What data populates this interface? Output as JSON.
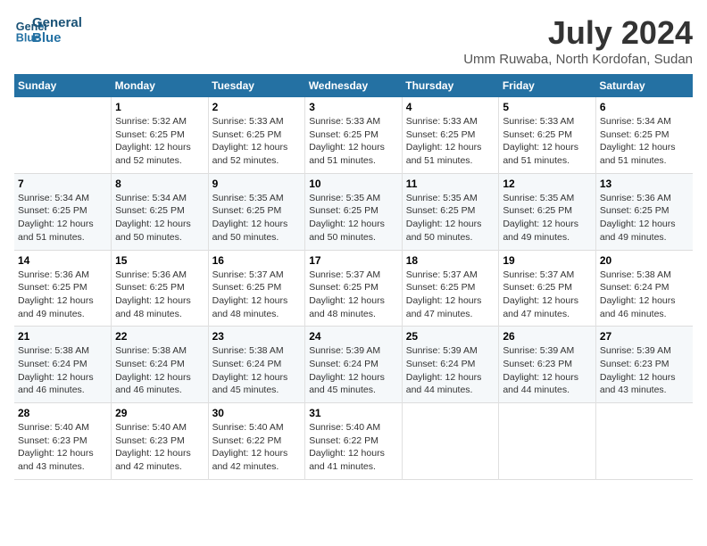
{
  "logo": {
    "line1": "General",
    "line2": "Blue"
  },
  "title": "July 2024",
  "subtitle": "Umm Ruwaba, North Kordofan, Sudan",
  "days_of_week": [
    "Sunday",
    "Monday",
    "Tuesday",
    "Wednesday",
    "Thursday",
    "Friday",
    "Saturday"
  ],
  "weeks": [
    [
      {
        "day": "",
        "info": ""
      },
      {
        "day": "1",
        "info": "Sunrise: 5:32 AM\nSunset: 6:25 PM\nDaylight: 12 hours\nand 52 minutes."
      },
      {
        "day": "2",
        "info": "Sunrise: 5:33 AM\nSunset: 6:25 PM\nDaylight: 12 hours\nand 52 minutes."
      },
      {
        "day": "3",
        "info": "Sunrise: 5:33 AM\nSunset: 6:25 PM\nDaylight: 12 hours\nand 51 minutes."
      },
      {
        "day": "4",
        "info": "Sunrise: 5:33 AM\nSunset: 6:25 PM\nDaylight: 12 hours\nand 51 minutes."
      },
      {
        "day": "5",
        "info": "Sunrise: 5:33 AM\nSunset: 6:25 PM\nDaylight: 12 hours\nand 51 minutes."
      },
      {
        "day": "6",
        "info": "Sunrise: 5:34 AM\nSunset: 6:25 PM\nDaylight: 12 hours\nand 51 minutes."
      }
    ],
    [
      {
        "day": "7",
        "info": "Sunrise: 5:34 AM\nSunset: 6:25 PM\nDaylight: 12 hours\nand 51 minutes."
      },
      {
        "day": "8",
        "info": "Sunrise: 5:34 AM\nSunset: 6:25 PM\nDaylight: 12 hours\nand 50 minutes."
      },
      {
        "day": "9",
        "info": "Sunrise: 5:35 AM\nSunset: 6:25 PM\nDaylight: 12 hours\nand 50 minutes."
      },
      {
        "day": "10",
        "info": "Sunrise: 5:35 AM\nSunset: 6:25 PM\nDaylight: 12 hours\nand 50 minutes."
      },
      {
        "day": "11",
        "info": "Sunrise: 5:35 AM\nSunset: 6:25 PM\nDaylight: 12 hours\nand 50 minutes."
      },
      {
        "day": "12",
        "info": "Sunrise: 5:35 AM\nSunset: 6:25 PM\nDaylight: 12 hours\nand 49 minutes."
      },
      {
        "day": "13",
        "info": "Sunrise: 5:36 AM\nSunset: 6:25 PM\nDaylight: 12 hours\nand 49 minutes."
      }
    ],
    [
      {
        "day": "14",
        "info": "Sunrise: 5:36 AM\nSunset: 6:25 PM\nDaylight: 12 hours\nand 49 minutes."
      },
      {
        "day": "15",
        "info": "Sunrise: 5:36 AM\nSunset: 6:25 PM\nDaylight: 12 hours\nand 48 minutes."
      },
      {
        "day": "16",
        "info": "Sunrise: 5:37 AM\nSunset: 6:25 PM\nDaylight: 12 hours\nand 48 minutes."
      },
      {
        "day": "17",
        "info": "Sunrise: 5:37 AM\nSunset: 6:25 PM\nDaylight: 12 hours\nand 48 minutes."
      },
      {
        "day": "18",
        "info": "Sunrise: 5:37 AM\nSunset: 6:25 PM\nDaylight: 12 hours\nand 47 minutes."
      },
      {
        "day": "19",
        "info": "Sunrise: 5:37 AM\nSunset: 6:25 PM\nDaylight: 12 hours\nand 47 minutes."
      },
      {
        "day": "20",
        "info": "Sunrise: 5:38 AM\nSunset: 6:24 PM\nDaylight: 12 hours\nand 46 minutes."
      }
    ],
    [
      {
        "day": "21",
        "info": "Sunrise: 5:38 AM\nSunset: 6:24 PM\nDaylight: 12 hours\nand 46 minutes."
      },
      {
        "day": "22",
        "info": "Sunrise: 5:38 AM\nSunset: 6:24 PM\nDaylight: 12 hours\nand 46 minutes."
      },
      {
        "day": "23",
        "info": "Sunrise: 5:38 AM\nSunset: 6:24 PM\nDaylight: 12 hours\nand 45 minutes."
      },
      {
        "day": "24",
        "info": "Sunrise: 5:39 AM\nSunset: 6:24 PM\nDaylight: 12 hours\nand 45 minutes."
      },
      {
        "day": "25",
        "info": "Sunrise: 5:39 AM\nSunset: 6:24 PM\nDaylight: 12 hours\nand 44 minutes."
      },
      {
        "day": "26",
        "info": "Sunrise: 5:39 AM\nSunset: 6:23 PM\nDaylight: 12 hours\nand 44 minutes."
      },
      {
        "day": "27",
        "info": "Sunrise: 5:39 AM\nSunset: 6:23 PM\nDaylight: 12 hours\nand 43 minutes."
      }
    ],
    [
      {
        "day": "28",
        "info": "Sunrise: 5:40 AM\nSunset: 6:23 PM\nDaylight: 12 hours\nand 43 minutes."
      },
      {
        "day": "29",
        "info": "Sunrise: 5:40 AM\nSunset: 6:23 PM\nDaylight: 12 hours\nand 42 minutes."
      },
      {
        "day": "30",
        "info": "Sunrise: 5:40 AM\nSunset: 6:22 PM\nDaylight: 12 hours\nand 42 minutes."
      },
      {
        "day": "31",
        "info": "Sunrise: 5:40 AM\nSunset: 6:22 PM\nDaylight: 12 hours\nand 41 minutes."
      },
      {
        "day": "",
        "info": ""
      },
      {
        "day": "",
        "info": ""
      },
      {
        "day": "",
        "info": ""
      }
    ]
  ]
}
